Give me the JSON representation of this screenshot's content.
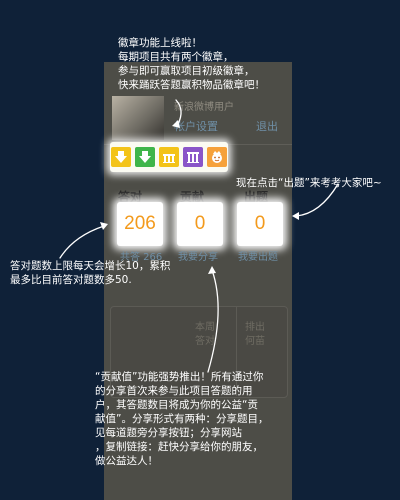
{
  "profile": {
    "username": "新浪微博用户",
    "account_settings": "帐户设置",
    "logout": "退出"
  },
  "badges": [
    {
      "icon": "down-arrow-badge-icon",
      "color": "#f3c318"
    },
    {
      "icon": "down-arrow-badge-icon",
      "color": "#3fb54a"
    },
    {
      "icon": "building-badge-icon",
      "color": "#f3c318"
    },
    {
      "icon": "building-badge-icon",
      "color": "#8a55c8"
    },
    {
      "icon": "face-badge-icon",
      "color": "#f6a13a"
    }
  ],
  "stats": [
    {
      "label": "答对",
      "value": "206",
      "sub": "共答 266"
    },
    {
      "label": "贡献",
      "value": "0",
      "sub": "我要分享"
    },
    {
      "label": "出题",
      "value": "0",
      "sub": "我要出题"
    }
  ],
  "lower": {
    "left_lines": [
      "本周",
      "答对"
    ],
    "right_lines": [
      "排出",
      "何苗"
    ]
  },
  "annotations": {
    "badge_tip": [
      "徽章功能上线啦！",
      "每期项目共有两个徽章，",
      "参与即可赢取项目初级徽章，",
      "快来踊跃答题赢积物品徽章吧！"
    ],
    "question_tip": "现在点击“出题”来考考大家吧~",
    "correct_tip": [
      "答对题数上限每天会增长10，累积",
      "最多比目前答对题数多50."
    ],
    "contribution_tip": [
      "“贡献值”功能强势推出！所有通过你",
      "的分享首次来参与此项目答题的用",
      "户，其答题数目将成为你的公益“贡",
      "献值”。分享形式有两种：分享题目，",
      "见每道题旁分享按钮；分享网站",
      "，复制链接：赶快分享给你的朋友，",
      "做公益达人！"
    ]
  }
}
